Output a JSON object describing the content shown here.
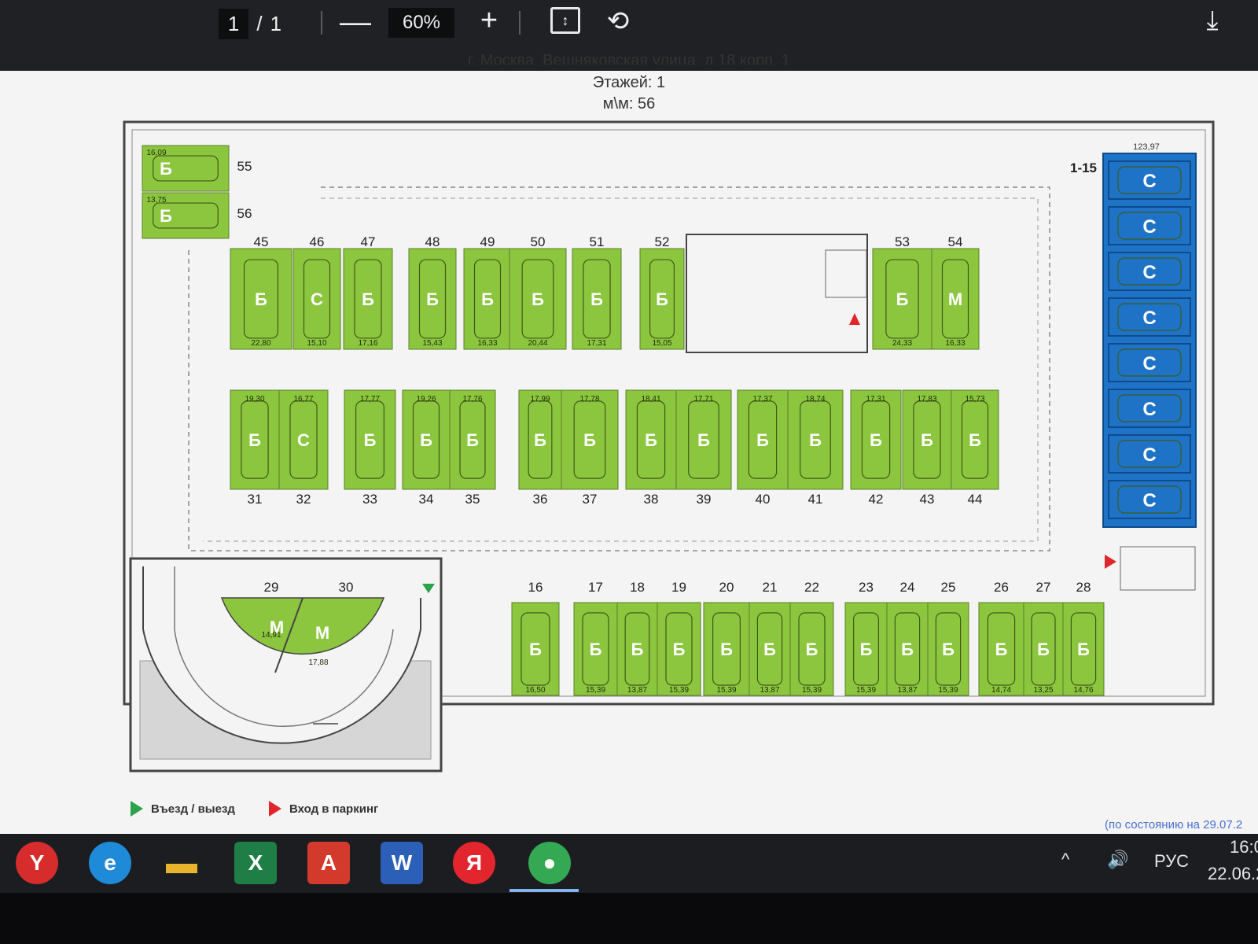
{
  "toolbar": {
    "page_current": "1",
    "page_sep": "/",
    "page_total": "1",
    "zoom_out_label": "—",
    "zoom_value": "60%",
    "zoom_in_label": "+",
    "fit_icon": "fit-page-icon",
    "rotate_icon": "rotate-icon",
    "download_icon": "download-icon"
  },
  "document": {
    "header_address": "г. Москва, Вешняковская улица, д 18 корп. 1",
    "header_floors": "Этажей: 1",
    "header_spots": "м\\м: 56",
    "legend_entry_exit": "Въезд / выезд",
    "legend_parking_entrance": "Вход в паркинг",
    "status_text": "(по состоянию на 29.07.2",
    "colors": {
      "spot_green": "#8cc63f",
      "spot_blue": "#1f73c7",
      "wall": "#444444"
    },
    "blue_block": {
      "label": "1-15",
      "area": "123,97",
      "letter": "С",
      "count": 8
    },
    "spots_top_row": [
      {
        "num": "45",
        "letter": "Б",
        "area": "22,80"
      },
      {
        "num": "46",
        "letter": "С",
        "area": "15,10"
      },
      {
        "num": "47",
        "letter": "Б",
        "area": "17,16"
      },
      {
        "num": "48",
        "letter": "Б",
        "area": "15,43"
      },
      {
        "num": "49",
        "letter": "Б",
        "area": "16,33"
      },
      {
        "num": "50",
        "letter": "Б",
        "area": "20,44"
      },
      {
        "num": "51",
        "letter": "Б",
        "area": "17,31"
      },
      {
        "num": "52",
        "letter": "Б",
        "area": "15,05"
      },
      {
        "num": "53",
        "letter": "Б",
        "area": "24,33"
      },
      {
        "num": "54",
        "letter": "М",
        "area": "16,33"
      }
    ],
    "spots_left_col": [
      {
        "num": "55",
        "letter": "Б",
        "area": "16,09"
      },
      {
        "num": "56",
        "letter": "Б",
        "area": "13,75"
      }
    ],
    "spots_middle_row": [
      {
        "num": "31",
        "letter": "Б",
        "area": "19,30"
      },
      {
        "num": "32",
        "letter": "С",
        "area": "16,77"
      },
      {
        "num": "33",
        "letter": "Б",
        "area": "17,77"
      },
      {
        "num": "34",
        "letter": "Б",
        "area": "19,26"
      },
      {
        "num": "35",
        "letter": "Б",
        "area": "17,76"
      },
      {
        "num": "36",
        "letter": "Б",
        "area": "17,99"
      },
      {
        "num": "37",
        "letter": "Б",
        "area": "17,78"
      },
      {
        "num": "38",
        "letter": "Б",
        "area": "18,41"
      },
      {
        "num": "39",
        "letter": "Б",
        "area": "17,71"
      },
      {
        "num": "40",
        "letter": "Б",
        "area": "17,37"
      },
      {
        "num": "41",
        "letter": "Б",
        "area": "18,74"
      },
      {
        "num": "42",
        "letter": "Б",
        "area": "17,31"
      },
      {
        "num": "43",
        "letter": "Б",
        "area": "17,83"
      },
      {
        "num": "44",
        "letter": "Б",
        "area": "15,73"
      }
    ],
    "spots_bottom_row": [
      {
        "num": "16",
        "letter": "Б",
        "area": "16,50"
      },
      {
        "num": "17",
        "letter": "Б",
        "area": "15,39"
      },
      {
        "num": "18",
        "letter": "Б",
        "area": "13,87"
      },
      {
        "num": "19",
        "letter": "Б",
        "area": "15,39"
      },
      {
        "num": "20",
        "letter": "Б",
        "area": "15,39"
      },
      {
        "num": "21",
        "letter": "Б",
        "area": "13,87"
      },
      {
        "num": "22",
        "letter": "Б",
        "area": "15,39"
      },
      {
        "num": "23",
        "letter": "Б",
        "area": "15,39"
      },
      {
        "num": "24",
        "letter": "Б",
        "area": "13,87"
      },
      {
        "num": "25",
        "letter": "Б",
        "area": "15,39"
      },
      {
        "num": "26",
        "letter": "Б",
        "area": "14,74"
      },
      {
        "num": "27",
        "letter": "Б",
        "area": "13,25"
      },
      {
        "num": "28",
        "letter": "Б",
        "area": "14,76"
      }
    ],
    "spots_curve": [
      {
        "num": "29",
        "letter": "М",
        "area": "14,91"
      },
      {
        "num": "30",
        "letter": "М",
        "area": "17,88"
      }
    ]
  },
  "taskbar": {
    "apps": [
      {
        "name": "yandex-browser-icon",
        "glyph": "Y"
      },
      {
        "name": "edge-icon",
        "glyph": "e"
      },
      {
        "name": "file-explorer-icon",
        "glyph": "▬"
      },
      {
        "name": "excel-icon",
        "glyph": "X"
      },
      {
        "name": "acrobat-icon",
        "glyph": "A"
      },
      {
        "name": "word-icon",
        "glyph": "W"
      },
      {
        "name": "yandex-icon",
        "glyph": "Я"
      },
      {
        "name": "chrome-icon",
        "glyph": "●"
      }
    ],
    "tray_chevron": "^",
    "tray_volume": "🔊",
    "language": "РУС",
    "time": "16:0",
    "date": "22.06.2"
  }
}
